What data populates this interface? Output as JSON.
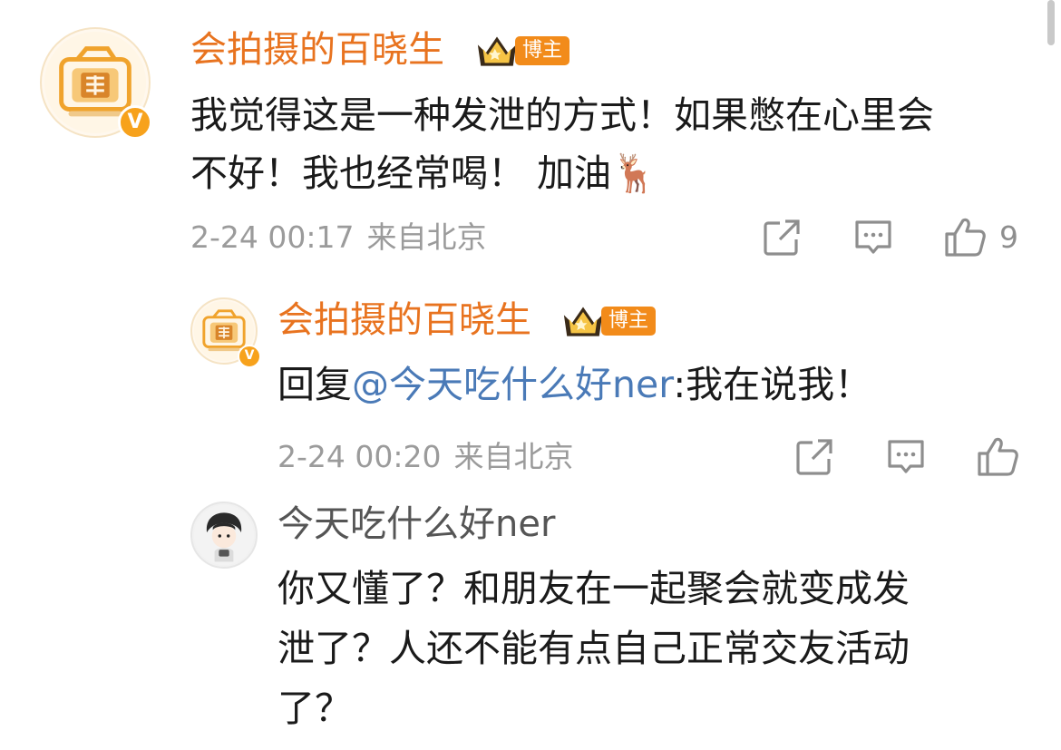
{
  "comments": [
    {
      "username": "会拍摄的百晓生",
      "badge": "博主",
      "text_line1": "我觉得这是一种发泄的方式！如果憋在心里会",
      "text_line2": "不好！我也经常喝！ 加油🦌",
      "time": "2-24 00:17",
      "location": "来自北京",
      "likes": "9"
    },
    {
      "username": "会拍摄的百晓生",
      "badge": "博主",
      "reply_prefix": "回复",
      "mention": "@今天吃什么好ner",
      "reply_text": ":我在说我！",
      "time": "2-24 00:20",
      "location": "来自北京"
    },
    {
      "username": "今天吃什么好ner",
      "text_line1": "你又懂了？和朋友在一起聚会就变成发",
      "text_line2": "泄了？人还不能有点自己正常交友活动",
      "text_line3": "了？"
    }
  ],
  "colors": {
    "username": "#e8731f",
    "badge": "#f28b1a",
    "mention": "#4a7ab7",
    "meta": "#9b9b9b"
  },
  "icons": [
    "share-icon",
    "comment-icon",
    "like-icon",
    "crown-icon",
    "verified-badge-icon"
  ]
}
